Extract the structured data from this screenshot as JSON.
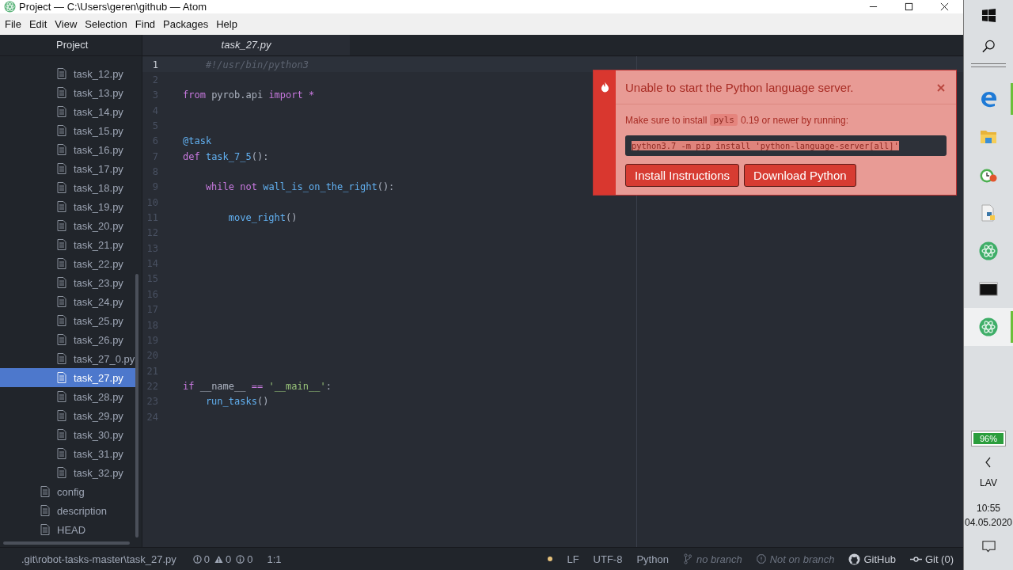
{
  "window": {
    "title": "Project — C:\\Users\\geren\\github — Atom"
  },
  "menu": [
    "File",
    "Edit",
    "View",
    "Selection",
    "Find",
    "Packages",
    "Help"
  ],
  "sidebar": {
    "title": "Project",
    "nested_files": [
      {
        "name": "task_12.py",
        "selected": false
      },
      {
        "name": "task_13.py",
        "selected": false
      },
      {
        "name": "task_14.py",
        "selected": false
      },
      {
        "name": "task_15.py",
        "selected": false
      },
      {
        "name": "task_16.py",
        "selected": false
      },
      {
        "name": "task_17.py",
        "selected": false
      },
      {
        "name": "task_18.py",
        "selected": false
      },
      {
        "name": "task_19.py",
        "selected": false
      },
      {
        "name": "task_20.py",
        "selected": false
      },
      {
        "name": "task_21.py",
        "selected": false
      },
      {
        "name": "task_22.py",
        "selected": false
      },
      {
        "name": "task_23.py",
        "selected": false
      },
      {
        "name": "task_24.py",
        "selected": false
      },
      {
        "name": "task_25.py",
        "selected": false
      },
      {
        "name": "task_26.py",
        "selected": false
      },
      {
        "name": "task_27_0.py",
        "selected": false
      },
      {
        "name": "task_27.py",
        "selected": true
      },
      {
        "name": "task_28.py",
        "selected": false
      },
      {
        "name": "task_29.py",
        "selected": false
      },
      {
        "name": "task_30.py",
        "selected": false
      },
      {
        "name": "task_31.py",
        "selected": false
      },
      {
        "name": "task_32.py",
        "selected": false
      }
    ],
    "root_files": [
      {
        "name": "config",
        "selected": false
      },
      {
        "name": "description",
        "selected": false
      },
      {
        "name": "HEAD",
        "selected": false
      }
    ]
  },
  "tabs": [
    {
      "label": "task_27.py",
      "selected": true
    }
  ],
  "editor": {
    "lines": [
      {
        "number": "1",
        "current": true,
        "tokens": [
          {
            "text": "    #!/usr/bin/python3",
            "kind": "comment"
          }
        ]
      },
      {
        "number": "2",
        "current": false
      },
      {
        "number": "3",
        "current": false,
        "tokens": [
          {
            "text": "from",
            "kind": "keyword"
          },
          {
            "text": " pyrob.api ",
            "kind": "plain"
          },
          {
            "text": "import *",
            "kind": "keyword"
          }
        ]
      },
      {
        "number": "4",
        "current": false
      },
      {
        "number": "5",
        "current": false
      },
      {
        "number": "6",
        "current": false,
        "tokens": [
          {
            "text": "@task",
            "kind": "decorator"
          }
        ]
      },
      {
        "number": "7",
        "current": false,
        "tokens": [
          {
            "text": "def ",
            "kind": "keyword"
          },
          {
            "text": "task_7_5",
            "kind": "function"
          },
          {
            "text": "():",
            "kind": "plain"
          }
        ]
      },
      {
        "number": "8",
        "current": false
      },
      {
        "number": "9",
        "current": false,
        "tokens": [
          {
            "text": "    while not ",
            "kind": "keyword"
          },
          {
            "text": "wall_is_on_the_right",
            "kind": "function"
          },
          {
            "text": "():",
            "kind": "plain"
          }
        ]
      },
      {
        "number": "10",
        "current": false
      },
      {
        "number": "11",
        "current": false,
        "tokens": [
          {
            "text": "        move_right",
            "kind": "function"
          },
          {
            "text": "()",
            "kind": "plain"
          }
        ]
      },
      {
        "number": "12",
        "current": false
      },
      {
        "number": "13",
        "current": false
      },
      {
        "number": "14",
        "current": false
      },
      {
        "number": "15",
        "current": false
      },
      {
        "number": "16",
        "current": false
      },
      {
        "number": "17",
        "current": false
      },
      {
        "number": "18",
        "current": false
      },
      {
        "number": "19",
        "current": false
      },
      {
        "number": "20",
        "current": false
      },
      {
        "number": "21",
        "current": false
      },
      {
        "number": "22",
        "current": false,
        "tokens": [
          {
            "text": "if ",
            "kind": "keyword"
          },
          {
            "text": "__name__ ",
            "kind": "plain"
          },
          {
            "text": "== ",
            "kind": "keyword"
          },
          {
            "text": "'__main__'",
            "kind": "string"
          },
          {
            "text": ":",
            "kind": "plain"
          }
        ]
      },
      {
        "number": "23",
        "current": false,
        "tokens": [
          {
            "text": "    run_tasks",
            "kind": "function"
          },
          {
            "text": "()",
            "kind": "plain"
          }
        ]
      },
      {
        "number": "24",
        "current": false
      }
    ]
  },
  "notification": {
    "title": "Unable to start the Python language server.",
    "message_start": "Make sure to install",
    "message_code": "pyls",
    "message_end": "0.19 or newer by running:",
    "command": "python3.7 -m pip install 'python-language-server[all]'",
    "buttons": [
      "Install Instructions",
      "Download Python"
    ]
  },
  "status_bar": {
    "path": ".git\\robot-tasks-master\\task_27.py",
    "errors": "0",
    "warnings": "0",
    "infos": "0",
    "cursor": "1:1",
    "modified": true,
    "line_ending": "LF",
    "encoding": "UTF-8",
    "grammar": "Python",
    "branch": "no branch",
    "branch_status": "Not on branch",
    "github": "GitHub",
    "git": "Git (0)"
  },
  "taskbar": {
    "apps": [
      {
        "kind": "edge",
        "running": true,
        "selected": false
      },
      {
        "kind": "folder",
        "running": false,
        "selected": false
      },
      {
        "kind": "alarm",
        "running": false,
        "selected": false
      },
      {
        "kind": "python",
        "running": false,
        "selected": false
      },
      {
        "kind": "atom",
        "running": false,
        "selected": false
      },
      {
        "kind": "terminal",
        "running": false,
        "selected": false
      },
      {
        "kind": "atom",
        "running": true,
        "selected": true
      }
    ],
    "battery": "96%",
    "language": "LAV",
    "time": "10:55",
    "date": "04.05.2020"
  }
}
